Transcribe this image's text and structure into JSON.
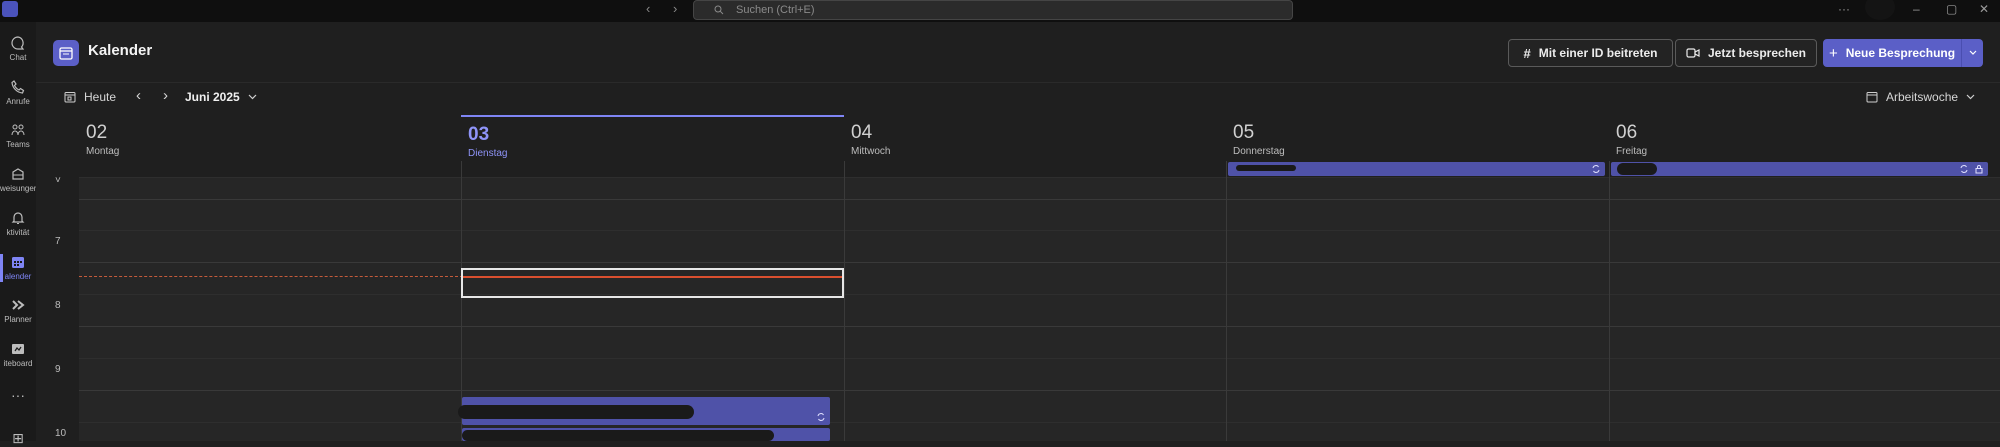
{
  "titlebar": {
    "search_placeholder": "Suchen (Ctrl+E)",
    "more": "···"
  },
  "rail": {
    "items": [
      {
        "label": "Chat",
        "icon": "chat-icon"
      },
      {
        "label": "Anrufe",
        "icon": "phone-icon"
      },
      {
        "label": "Teams",
        "icon": "teams-icon"
      },
      {
        "label": "weisungen",
        "icon": "assignments-icon"
      },
      {
        "label": "ktivität",
        "icon": "bell-icon"
      },
      {
        "label": "alender",
        "icon": "calendar-icon"
      },
      {
        "label": "Planner",
        "icon": "planner-icon"
      },
      {
        "label": "iteboard",
        "icon": "whiteboard-icon"
      }
    ],
    "more": "···",
    "accent": "#7f85f5"
  },
  "header": {
    "title": "Kalender",
    "join_id_label": "Mit einer ID beitreten",
    "meet_now_label": "Jetzt besprechen",
    "new_meeting_label": "Neue Besprechung",
    "accent": "#5b5fc7"
  },
  "toolbar": {
    "today_label": "Heute",
    "month_label": "Juni 2025",
    "view_label": "Arbeitswoche"
  },
  "days": [
    {
      "num": "02",
      "name": "Montag"
    },
    {
      "num": "03",
      "name": "Dienstag",
      "today": true
    },
    {
      "num": "04",
      "name": "Mittwoch"
    },
    {
      "num": "05",
      "name": "Donnerstag"
    },
    {
      "num": "06",
      "name": "Freitag"
    }
  ],
  "hours": [
    "7",
    "8",
    "9",
    "10"
  ],
  "colors": {
    "event": "#4f52a8",
    "now_line": "#d94f2f"
  }
}
